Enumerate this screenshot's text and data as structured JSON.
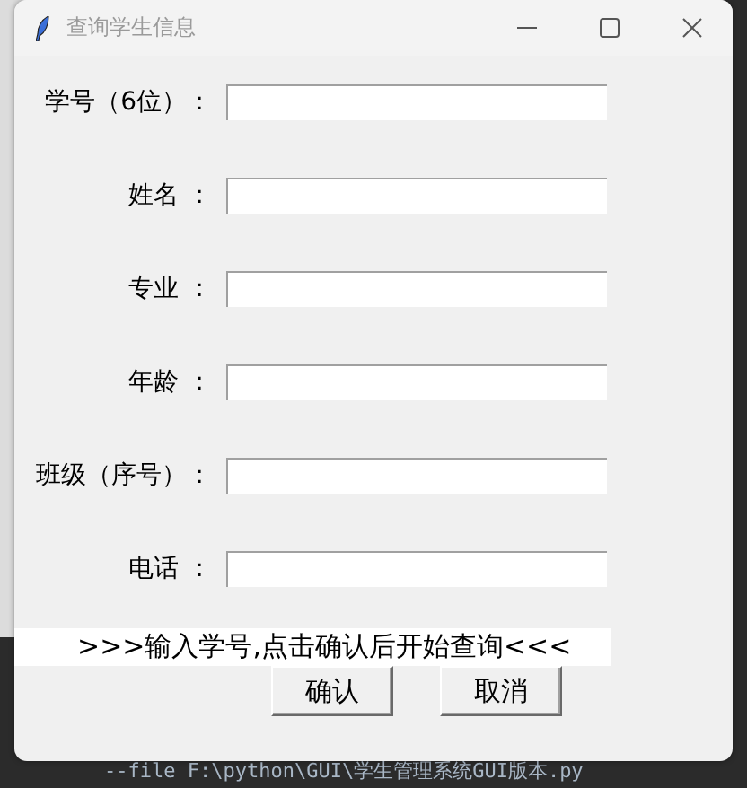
{
  "window": {
    "title": "查询学生信息"
  },
  "fields": [
    {
      "label": "学号（6位）："
    },
    {
      "label": "姓名 ："
    },
    {
      "label": "专业 ："
    },
    {
      "label": "年龄 ："
    },
    {
      "label": "班级（序号）："
    },
    {
      "label": "电话 ："
    }
  ],
  "message": ">>>输入学号,点击确认后开始查询<<<",
  "buttons": [
    "确认",
    "取消"
  ],
  "terminal": {
    "text": "--file F:\\python\\GUI\\学生管理系统GUI版本.py"
  }
}
